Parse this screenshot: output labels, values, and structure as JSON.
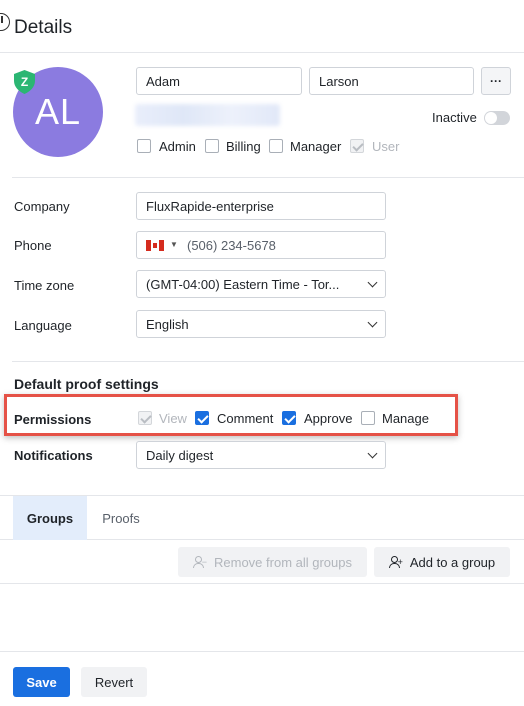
{
  "header": {
    "title": "Details"
  },
  "user": {
    "initials": "AL",
    "first_name": "Adam",
    "last_name": "Larson",
    "more_label": "···",
    "inactive_label": "Inactive",
    "roles": [
      {
        "label": "Admin",
        "checked": false
      },
      {
        "label": "Billing",
        "checked": false
      },
      {
        "label": "Manager",
        "checked": false
      },
      {
        "label": "User",
        "checked": true,
        "disabled": true
      }
    ]
  },
  "fields": {
    "company": {
      "label": "Company",
      "value": "FluxRapide-enterprise"
    },
    "phone": {
      "label": "Phone",
      "value": "(506) 234-5678",
      "country": "CA"
    },
    "timezone": {
      "label": "Time zone",
      "value": "(GMT-04:00) Eastern Time - Tor..."
    },
    "language": {
      "label": "Language",
      "value": "English"
    }
  },
  "proof_settings": {
    "title": "Default proof settings",
    "permissions_label": "Permissions",
    "permissions": [
      {
        "label": "View",
        "checked": true,
        "disabled": true
      },
      {
        "label": "Comment",
        "checked": true
      },
      {
        "label": "Approve",
        "checked": true
      },
      {
        "label": "Manage",
        "checked": false
      }
    ],
    "notifications_label": "Notifications",
    "notifications_value": "Daily digest"
  },
  "tabs": [
    {
      "label": "Groups",
      "active": true
    },
    {
      "label": "Proofs",
      "active": false
    }
  ],
  "group_actions": {
    "remove_label": "Remove from all groups",
    "add_label": "Add to a group"
  },
  "footer": {
    "save_label": "Save",
    "revert_label": "Revert"
  },
  "colors": {
    "accent": "#1a6fe0",
    "avatar": "#8b7be0",
    "highlight": "#e55247",
    "shield": "#2bb673"
  }
}
